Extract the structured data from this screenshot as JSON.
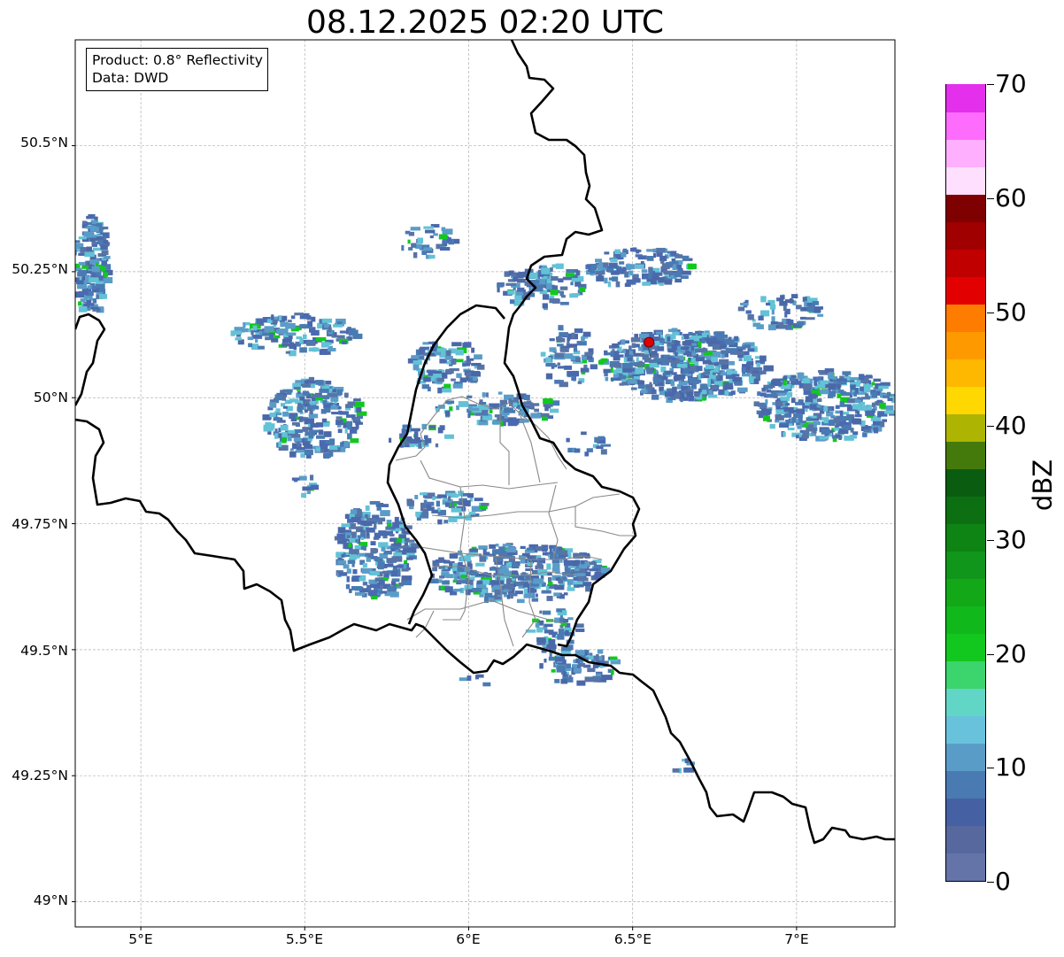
{
  "title": "08.12.2025 02:20 UTC",
  "info": {
    "product": "Product: 0.8° Reflectivity",
    "source": "Data: DWD"
  },
  "axes": {
    "lat_labels": [
      "50.5°N",
      "50.25°N",
      "50°N",
      "49.75°N",
      "49.5°N",
      "49.25°N",
      "49°N"
    ],
    "lon_labels": [
      "5°E",
      "5.5°E",
      "6°E",
      "6.5°E",
      "7°E"
    ],
    "lon_range": [
      4.8,
      7.3
    ],
    "lat_range": [
      48.95,
      50.71
    ],
    "grid": true
  },
  "colorbar": {
    "unit": "dBZ",
    "tick_labels": [
      "0",
      "10",
      "20",
      "30",
      "40",
      "50",
      "60",
      "70"
    ],
    "range": [
      0,
      70
    ],
    "colors": [
      "#6474a8",
      "#56689e",
      "#4660a4",
      "#4a7ab2",
      "#5a9cc8",
      "#68c2dc",
      "#62d6c6",
      "#3cd46c",
      "#12c81e",
      "#10b81c",
      "#12a818",
      "#10961a",
      "#0e8414",
      "#0c7012",
      "#0a5c10",
      "#447a0c",
      "#aeb402",
      "#fed800",
      "#feb800",
      "#fe9a00",
      "#fe7c00",
      "#e20000",
      "#c00000",
      "#a00000",
      "#7e0000",
      "#fee0fe",
      "#feb0fe",
      "#fe6cfe",
      "#e430ec"
    ]
  },
  "radar_site": {
    "lon": 6.55,
    "lat": 50.11,
    "color": "#e00000"
  },
  "colors": {
    "border": "#000000",
    "admin": "#888888",
    "grid": "#b0b0b0"
  }
}
